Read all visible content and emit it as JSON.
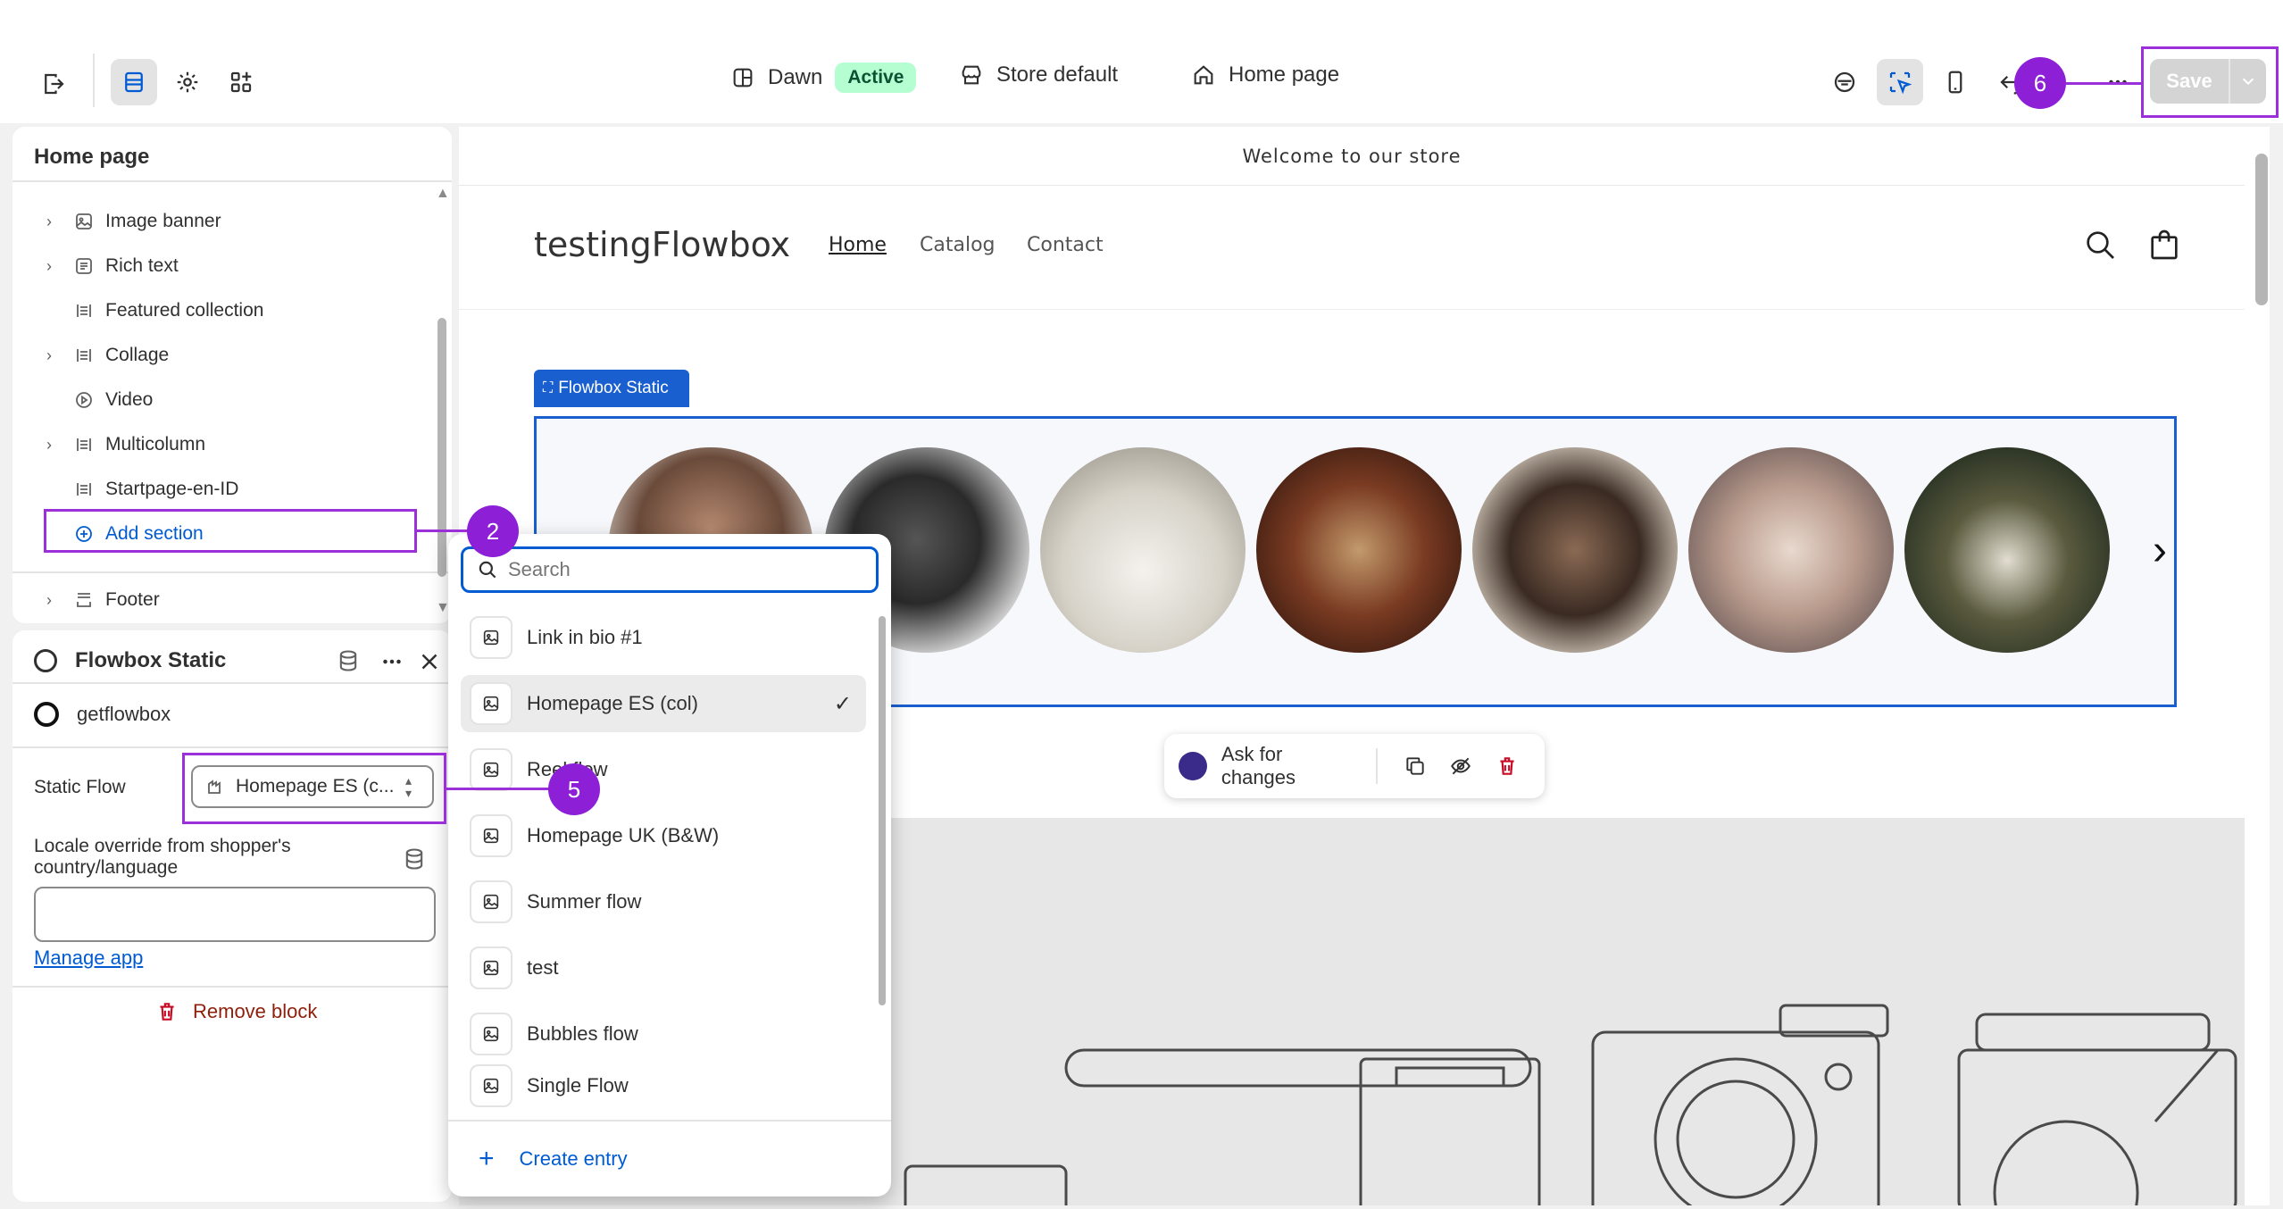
{
  "topbar": {
    "theme_name": "Dawn",
    "theme_status": "Active",
    "store_context": "Store default",
    "page_context": "Home page",
    "save_label": "Save"
  },
  "sections_panel": {
    "title": "Home page",
    "items": [
      {
        "label": "Image banner",
        "expandable": true,
        "icon": "image-icon"
      },
      {
        "label": "Rich text",
        "expandable": true,
        "icon": "text-block-icon"
      },
      {
        "label": "Featured collection",
        "expandable": false,
        "icon": "layout-icon"
      },
      {
        "label": "Collage",
        "expandable": true,
        "icon": "layout-icon"
      },
      {
        "label": "Video",
        "expandable": false,
        "icon": "play-icon"
      },
      {
        "label": "Multicolumn",
        "expandable": true,
        "icon": "layout-icon"
      },
      {
        "label": "Startpage-en-ID",
        "expandable": false,
        "icon": "layout-icon"
      }
    ],
    "add_section_label": "Add section",
    "footer_label": "Footer"
  },
  "block_panel": {
    "title": "Flowbox Static",
    "app_name": "getflowbox",
    "static_flow_label": "Static Flow",
    "static_flow_value": "Homepage ES (c...",
    "locale_label_line1": "Locale override from shopper's",
    "locale_label_line2": "country/language",
    "locale_value": "",
    "manage_app_label": "Manage app",
    "remove_block_label": "Remove block"
  },
  "dropdown": {
    "search_placeholder": "Search",
    "options": [
      {
        "label": "Link in bio #1",
        "selected": false
      },
      {
        "label": "Homepage ES (col)",
        "selected": true
      },
      {
        "label": "Reel flow",
        "selected": false
      },
      {
        "label": "Homepage UK (B&W)",
        "selected": false
      },
      {
        "label": "Summer flow",
        "selected": false
      },
      {
        "label": "test",
        "selected": false
      },
      {
        "label": "Bubbles flow",
        "selected": false
      },
      {
        "label": "Single Flow",
        "selected": false
      }
    ],
    "create_entry_label": "Create entry"
  },
  "preview": {
    "announcement": "Welcome to our store",
    "store_name": "testingFlowbox",
    "nav": [
      "Home",
      "Catalog",
      "Contact"
    ],
    "flowbox_tag": "Flowbox Static",
    "ask_label": "Ask for changes"
  },
  "annotations": [
    "2",
    "5",
    "6"
  ],
  "colors": {
    "accent": "#005bd3",
    "annotation": "#8d1fd6",
    "active_badge": "#b4fed2",
    "danger": "#8e1f0b"
  }
}
